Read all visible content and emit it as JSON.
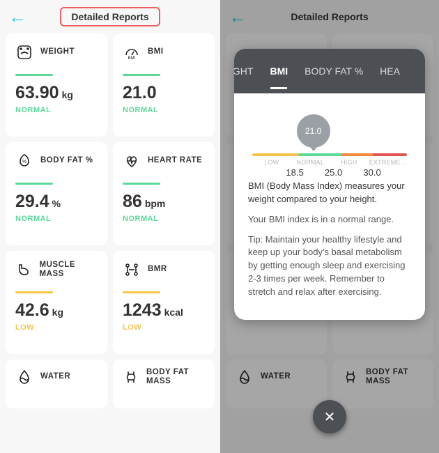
{
  "header": {
    "title": "Detailed Reports"
  },
  "cards": {
    "weight": {
      "label": "WEIGHT",
      "value": "63.90",
      "unit": "kg",
      "status": "NORMAL",
      "statusClass": "st-normal",
      "accent": "green"
    },
    "bmi": {
      "label": "BMI",
      "value": "21.0",
      "unit": "",
      "status": "NORMAL",
      "statusClass": "st-normal",
      "accent": "green"
    },
    "bodyfat": {
      "label": "BODY FAT %",
      "value": "29.4",
      "unit": "%",
      "status": "NORMAL",
      "statusClass": "st-normal",
      "accent": "green"
    },
    "heart": {
      "label": "HEART RATE",
      "value": "86",
      "unit": "bpm",
      "status": "NORMAL",
      "statusClass": "st-normal",
      "accent": "green"
    },
    "muscle": {
      "label": "MUSCLE MASS",
      "value": "42.6",
      "unit": "kg",
      "status": "LOW",
      "statusClass": "st-low",
      "accent": "yellow"
    },
    "bmr": {
      "label": "BMR",
      "value": "1243",
      "unit": "kcal",
      "status": "LOW",
      "statusClass": "st-low",
      "accent": "yellow"
    },
    "water": {
      "label": "WATER"
    },
    "bfmass": {
      "label": "BODY FAT MASS"
    }
  },
  "modal": {
    "tabs": {
      "t0": "IGHT",
      "t1": "BMI",
      "t2": "BODY FAT %",
      "t3": "HEA"
    },
    "gauge_value": "21.0",
    "ranges": {
      "r0": "LOW",
      "r1": "NORMAL",
      "r2": "HIGH",
      "r3": "EXTREME..."
    },
    "ticks": {
      "v0": "18.5",
      "v1": "25.0",
      "v2": "30.0"
    },
    "heading": "BMI (Body Mass Index) measures your weight compared to your height.",
    "p1": "Your BMI index is in a normal range.",
    "p2": "Tip: Maintain your healthy lifestyle and keep up your body's basal metabolism by getting enough sleep and exercising 2-3 times per week. Remember to stretch and relax after exercising."
  }
}
